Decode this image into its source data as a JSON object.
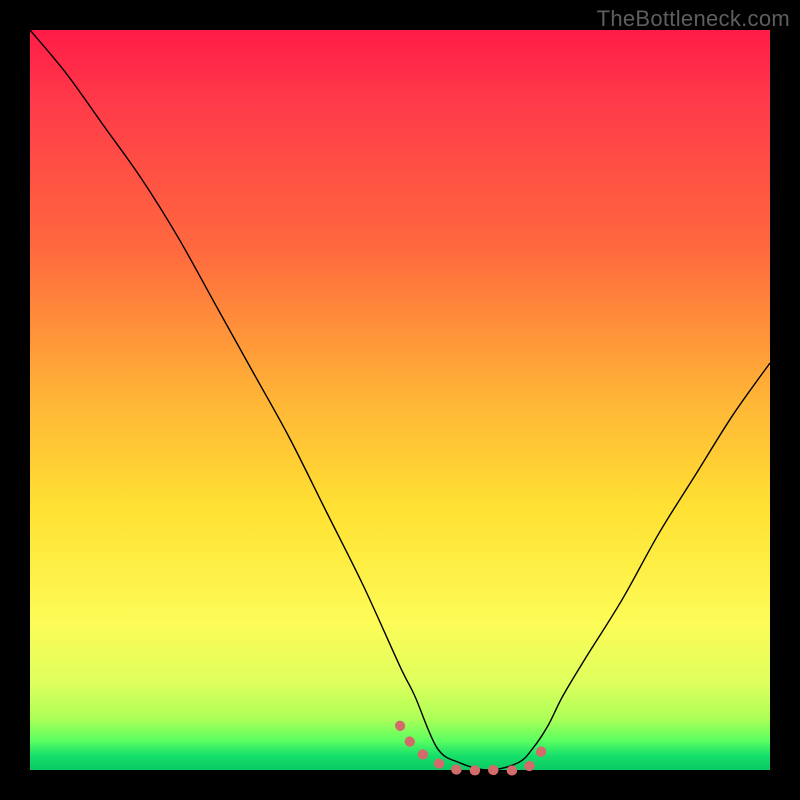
{
  "watermark": "TheBottleneck.com",
  "colors": {
    "page_bg": "#000000",
    "watermark": "#5e5e5e",
    "curve": "#000000",
    "baseline_dots": "#d46b6b",
    "gradient_stops": [
      "#ff1c47",
      "#ff3b49",
      "#ff6a3e",
      "#ffb536",
      "#ffe233",
      "#fdfb57",
      "#e0ff5d",
      "#adff57",
      "#5cff60",
      "#17e06a",
      "#09c964"
    ]
  },
  "chart_data": {
    "type": "line",
    "title": "",
    "xlabel": "",
    "ylabel": "",
    "xlim": [
      0,
      100
    ],
    "ylim": [
      0,
      100
    ],
    "legend": false,
    "grid": false,
    "note": "No axis ticks shown; values are normalized 0–100. y=0 at bottom (green), y=100 at top (red). Curve resembles a bottleneck V with a flat zero minimum roughly over x≈55–68. Separate salmon dotted segment traces the near-zero baseline around the trough.",
    "series": [
      {
        "name": "bottleneck-curve",
        "x": [
          0,
          5,
          10,
          15,
          20,
          25,
          30,
          35,
          40,
          45,
          50,
          52,
          55,
          58,
          62,
          66,
          68,
          70,
          72,
          75,
          80,
          85,
          90,
          95,
          100
        ],
        "y": [
          100,
          94,
          87,
          80,
          72,
          63,
          54,
          45,
          35,
          25,
          14,
          10,
          3,
          1,
          0,
          1,
          3,
          6,
          10,
          15,
          23,
          32,
          40,
          48,
          55
        ]
      },
      {
        "name": "baseline-dotted",
        "style": "dotted",
        "color": "#d46b6b",
        "x": [
          50,
          52,
          55,
          58,
          62,
          66,
          68,
          70
        ],
        "y": [
          6,
          3,
          1,
          0,
          0,
          0,
          1,
          4
        ]
      }
    ]
  }
}
